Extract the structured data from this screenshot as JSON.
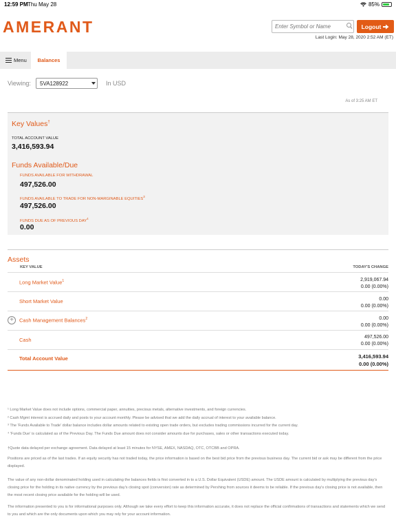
{
  "status_bar": {
    "time": "12:59 PM",
    "date": "Thu May 28",
    "battery": "85%",
    "battery_level": 0.85
  },
  "header": {
    "logo": "AMERANT",
    "search_placeholder": "Enter Symbol or Name",
    "logout_label": "Logout",
    "last_login": "Last Login: May 28, 2020 2:52 AM (ET)"
  },
  "nav": {
    "menu_label": "Menu",
    "active_tab": "Balances"
  },
  "viewing": {
    "label": "Viewing:",
    "account": "5VA128922",
    "currency": "In USD",
    "as_of": "As of 3:25 AM ET"
  },
  "key_values": {
    "title": "Key Values",
    "title_sup": "†",
    "total_label": "TOTAL ACCOUNT VALUE",
    "total_value": "3,416,593.94"
  },
  "funds": {
    "title": "Funds Available/Due",
    "withdrawal_label": "FUNDS AVAILABLE FOR WITHDRAWAL",
    "withdrawal_value": "497,526.00",
    "trade_label": "FUNDS AVAILABLE TO TRADE FOR NON-MARGINABLE EQUITIES",
    "trade_sup": "3",
    "trade_value": "497,526.00",
    "due_label": "FUNDS DUE AS OF PREVIOUS DAY",
    "due_sup": "4",
    "due_value": "0.00"
  },
  "assets": {
    "title": "Assets",
    "col_key": "KEY VALUE",
    "col_change": "TODAY'S CHANGE",
    "rows": [
      {
        "name": "Long Market Value",
        "sup": "1",
        "value": "2,919,067.94",
        "change": "0.00  (0.00%)"
      },
      {
        "name": "Short Market Value",
        "sup": "",
        "value": "0.00",
        "change": "0.00  (0.00%)"
      },
      {
        "name": "Cash Management Balances",
        "sup": "2",
        "value": "0.00",
        "change": "0.00  (0.00%)"
      },
      {
        "name": "Cash",
        "sup": "",
        "value": "497,526.00",
        "change": "0.00  (0.00%)"
      }
    ],
    "total": {
      "name": "Total Account Value",
      "value": "3,416,593.94",
      "change": "0.00  (0.00%)"
    }
  },
  "footnotes": {
    "f1": "¹ Long Market Value does not include options, commercial paper, annuities, precious metals, alternative investments, and foreign currencies.",
    "f2": "² Cash Mgmt interest is accrued daily and posts to your account monthly. Please be advised that we add the daily accrual of interest to your available balance.",
    "f3": "³ The 'Funds Available to Trade' dollar balance includes dollar amounts related to existing open trade orders, but excludes trading commissions incurred for the current day.",
    "f4": "⁴ 'Funds Due' is calculated as of the Previous Day. The Funds Due amount does not consider amounts due for purchases, sales or other transactions executed today.",
    "quote": "†Quote data delayed per exchange agreement. Data delayed at least 15 minutes for NYSE, AMEX, NASDAQ, OTC, OTCBB and OPRA.",
    "positions": "Positions are priced as of the last trades. If an equity security has not traded today, the price information is based on the best bid price from the previous business day. The current bid or ask may be different from the price displayed.",
    "nondollar": "The value of any non-dollar denominated holding used in calculating the balances fields is first converted in to a U.S. Dollar Equivalent (USDE) amount. The USDE amount is calculated by multiplying the previous day's closing price for the holding in its native currency by the previous day's closing spot (conversion) rate as determined by Pershing from sources it deems to be reliable. If the previous day's closing price is not available, then the most recent closing price available for the holding will be used.",
    "info": "The information presented to you is for informational purposes only. Although we take every effort to keep this information accurate, it does not replace the official confirmations of transactions and statements which we send to you and which are the only documents upon which you may rely for your account information."
  }
}
